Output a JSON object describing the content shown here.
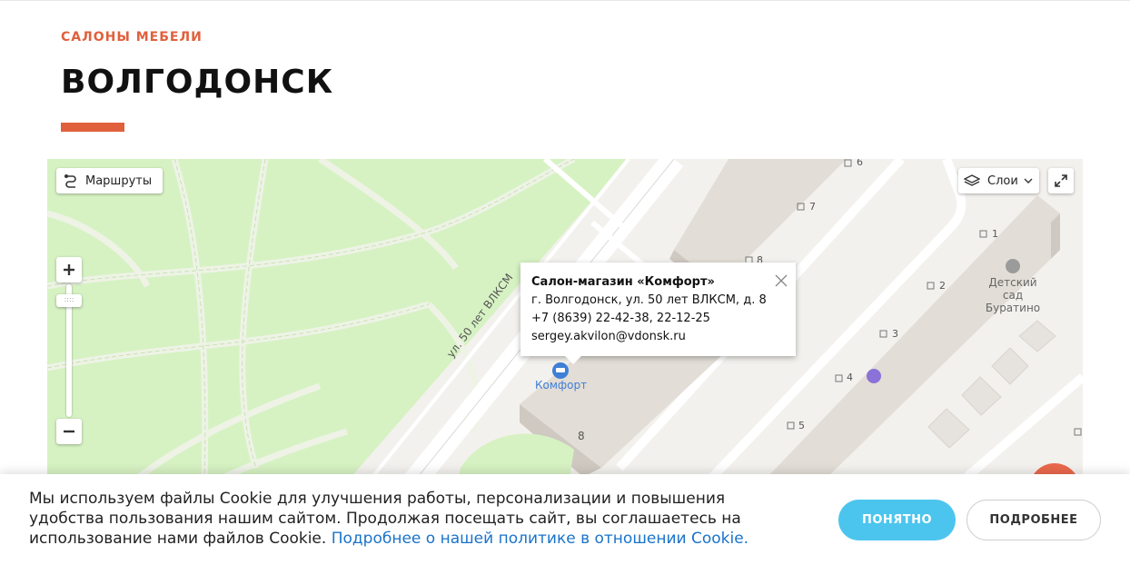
{
  "header": {
    "overline": "САЛОНЫ МЕБЕЛИ",
    "title": "ВОЛГОДОНСК"
  },
  "colors": {
    "accent": "#e0603c",
    "button_primary": "#4cc5ee",
    "link": "#1a73c9"
  },
  "map": {
    "routes_label": "Маршруты",
    "layers_label": "Слои",
    "street_label": "ул. 50 лет ВЛКСМ",
    "marker_label": "Комфорт",
    "place_label": "Детский сад Буратино",
    "building_numbers": [
      "6",
      "7",
      "8",
      "1",
      "2",
      "3",
      "4",
      "5",
      "8"
    ],
    "balloon": {
      "title": "Салон-магазин «Комфорт»",
      "address": "г. Волгодонск, ул. 50 лет ВЛКСМ, д. 8",
      "phone": "+7 (8639) 22-42-38, 22-12-25",
      "email": "sergey.akvilon@vdonsk.ru"
    }
  },
  "cookie": {
    "text": "Мы используем файлы Cookie для улучшения работы, персонализации и повышения удобства пользования нашим сайтом. Продолжая посещать сайт, вы соглашаетесь на использование нами файлов Cookie.",
    "link_text": "Подробнее о нашей политике в отношении Cookie.",
    "accept_label": "ПОНЯТНО",
    "more_label": "ПОДРОБНЕЕ"
  }
}
